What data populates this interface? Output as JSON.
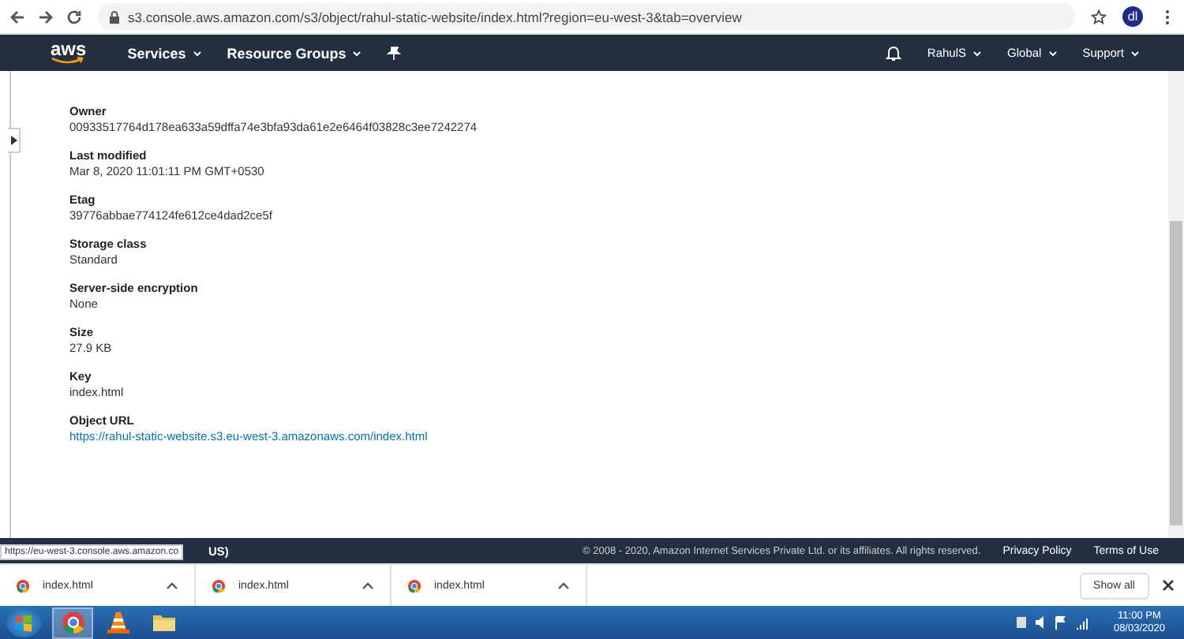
{
  "browser": {
    "url": "s3.console.aws.amazon.com/s3/object/rahul-static-website/index.html?region=eu-west-3&tab=overview",
    "avatar": "dl"
  },
  "nav": {
    "logo": "aws",
    "menus": [
      {
        "label": "Services"
      },
      {
        "label": "Resource Groups"
      }
    ],
    "right": [
      {
        "label": "RahulS"
      },
      {
        "label": "Global"
      },
      {
        "label": "Support"
      }
    ]
  },
  "properties": [
    {
      "label": "Owner",
      "value": "00933517764d178ea633a59dffa74e3bfa93da61e2e6464f03828c3ee7242274",
      "kind": "text"
    },
    {
      "label": "Last modified",
      "value": "Mar 8, 2020 11:01:11 PM GMT+0530",
      "kind": "text"
    },
    {
      "label": "Etag",
      "value": "39776abbae774124fe612ce4dad2ce5f",
      "kind": "text"
    },
    {
      "label": "Storage class",
      "value": "Standard",
      "kind": "text"
    },
    {
      "label": "Server-side encryption",
      "value": "None",
      "kind": "text"
    },
    {
      "label": "Size",
      "value": "27.9 KB",
      "kind": "text"
    },
    {
      "label": "Key",
      "value": "index.html",
      "kind": "text"
    },
    {
      "label": "Object URL",
      "value": "https://rahul-static-website.s3.eu-west-3.amazonaws.com/index.html",
      "kind": "link"
    }
  ],
  "footer": {
    "left": "US)",
    "copyright": "© 2008 - 2020, Amazon Internet Services Private Ltd. or its affiliates. All rights reserved.",
    "links": [
      "Privacy Policy",
      "Terms of Use"
    ]
  },
  "status_tooltip": "https://eu-west-3.console.aws.amazon.co",
  "downloads": {
    "items": [
      {
        "name": "index.html"
      },
      {
        "name": "index.html"
      },
      {
        "name": "index.html"
      }
    ],
    "show_all": "Show all"
  },
  "taskbar": {
    "time": "11:00 PM",
    "date": "08/03/2020"
  }
}
